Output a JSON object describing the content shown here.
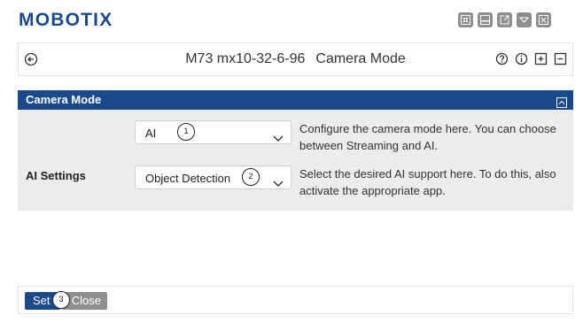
{
  "app": {
    "brand": "MOBOTIX"
  },
  "window_buttons": [
    {
      "icon": "layout-icon"
    },
    {
      "icon": "window-icon"
    },
    {
      "icon": "external-link-icon"
    },
    {
      "icon": "dropdown-icon"
    },
    {
      "icon": "close-icon"
    }
  ],
  "header": {
    "camera_name": "M73 mx10-32-6-96",
    "page_title": "Camera Mode"
  },
  "panel": {
    "title": "Camera Mode",
    "rows": [
      {
        "label": "",
        "value": "AI",
        "callout": "1",
        "description": "Configure the camera mode here. You can choose between Streaming and AI."
      },
      {
        "label": "AI Settings",
        "value": "Object Detection",
        "callout": "2",
        "description": "Select the desired AI support here. To do this, also activate the appropriate app."
      }
    ]
  },
  "footer": {
    "set_label": "Set",
    "close_label": "Close",
    "callout": "3"
  },
  "colors": {
    "brand_blue": "#1a4a8c",
    "panel_bg": "#ececec",
    "button_grey": "#8e8e8e"
  }
}
